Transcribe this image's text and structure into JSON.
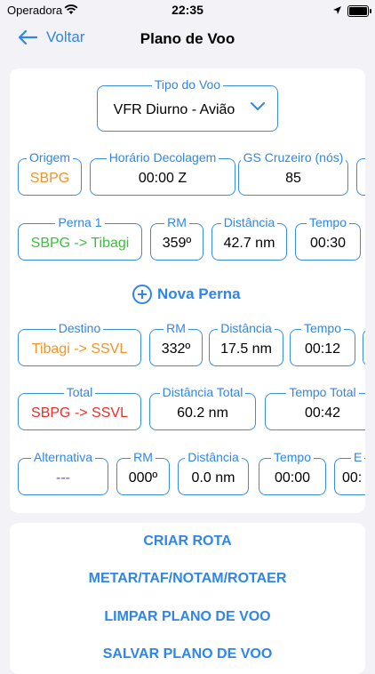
{
  "status_bar": {
    "carrier": "Operadora",
    "time": "22:35"
  },
  "nav": {
    "back_label": "Voltar",
    "title": "Plano de Voo"
  },
  "flight_type": {
    "label": "Tipo do Voo",
    "value": "VFR Diurno - Avião"
  },
  "departure": {
    "origin": {
      "label": "Origem",
      "value": "SBPG"
    },
    "takeoff_time": {
      "label": "Horário Decolagem",
      "value": "00:00 Z"
    },
    "gs_cruise": {
      "label": "GS Cruzeiro (nós)",
      "value": "85"
    }
  },
  "leg1": {
    "route": {
      "label": "Perna 1",
      "value": "SBPG -> Tibagi"
    },
    "rm": {
      "label": "RM",
      "value": "359º"
    },
    "distance": {
      "label": "Distância",
      "value": "42.7 nm"
    },
    "time": {
      "label": "Tempo",
      "value": "00:30"
    }
  },
  "add_leg_label": "Nova Perna",
  "destination": {
    "route": {
      "label": "Destino",
      "value": "Tibagi -> SSVL"
    },
    "rm": {
      "label": "RM",
      "value": "332º"
    },
    "distance": {
      "label": "Distância",
      "value": "17.5 nm"
    },
    "time": {
      "label": "Tempo",
      "value": "00:12"
    }
  },
  "total": {
    "route": {
      "label": "Total",
      "value": "SBPG -> SSVL"
    },
    "distance": {
      "label": "Distância Total",
      "value": "60.2 nm"
    },
    "time": {
      "label": "Tempo Total",
      "value": "00:42"
    }
  },
  "alternate": {
    "route": {
      "label": "Alternativa",
      "value": "---"
    },
    "rm": {
      "label": "RM",
      "value": "000º"
    },
    "distance": {
      "label": "Distância",
      "value": "0.0 nm"
    },
    "time": {
      "label": "Tempo",
      "value": "00:00"
    },
    "partial_label": "E",
    "partial_value": "00:"
  },
  "actions": {
    "create_route": "CRIAR ROTA",
    "weather": "METAR/TAF/NOTAM/ROTAER",
    "clear_plan": "LIMPAR PLANO DE VOO",
    "save_plan": "SALVAR PLANO DE VOO"
  },
  "colors": {
    "accent": "#2f86ea",
    "origin": "#f0952a",
    "leg": "#3cbf3c",
    "destination": "#f0952a",
    "total": "#e8302b",
    "alternate": "#7c4ad8"
  }
}
